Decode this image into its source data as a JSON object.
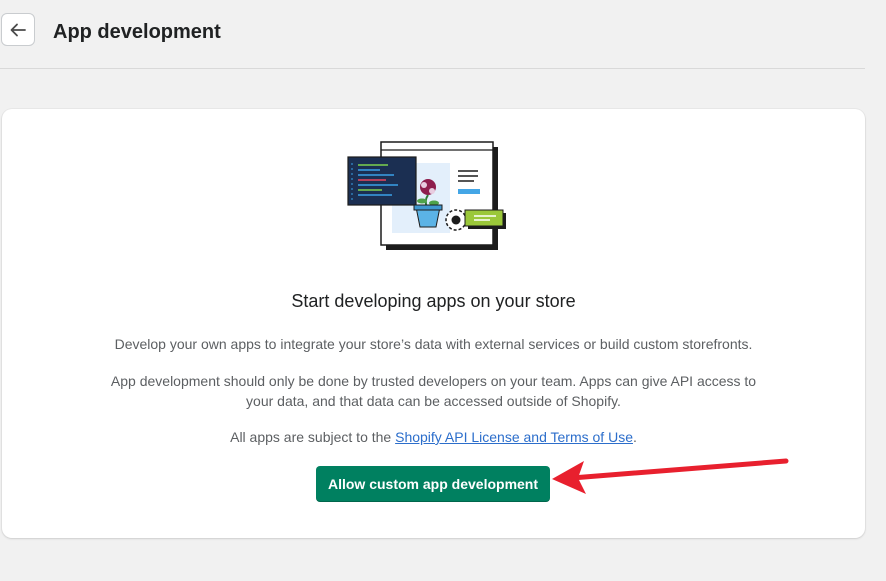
{
  "header": {
    "title": "App development",
    "back_icon": "arrow-left-icon"
  },
  "card": {
    "illustration": "app-development-illustration",
    "heading": "Start developing apps on your store",
    "description_1": "Develop your own apps to integrate your store’s data with external services or build custom storefronts.",
    "description_2": "App development should only be done by trusted developers on your team. Apps can give API access to your data, and that data can be accessed outside of Shopify.",
    "terms_prefix": "All apps are subject to the ",
    "terms_link": "Shopify API License and Terms of Use",
    "terms_suffix": ".",
    "cta_label": "Allow custom app development"
  },
  "annotation": {
    "arrow_color": "#e8202e"
  },
  "colors": {
    "primary": "#008060",
    "link": "#2c6ecb",
    "background": "#f1f1f1"
  }
}
